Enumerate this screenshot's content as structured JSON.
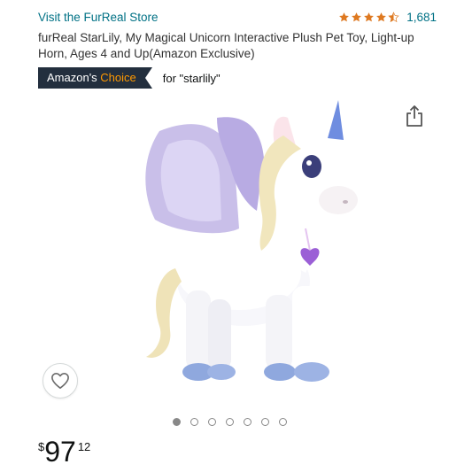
{
  "store": {
    "link_text": "Visit the FurReal Store"
  },
  "rating": {
    "stars": 4.5,
    "count": "1,681",
    "star_color": "#de7921"
  },
  "product": {
    "title": "furReal StarLily, My Magical Unicorn Interactive Plush Pet Toy, Light-up Horn, Ages 4 and Up(Amazon Exclusive)"
  },
  "badge": {
    "prefix": "Amazon's",
    "highlight": "Choice",
    "query": "for \"starlily\"",
    "bg_color": "#232f3e",
    "accent_color": "#ff9900"
  },
  "gallery": {
    "image_count": 7,
    "active_index": 0
  },
  "icons": {
    "share": "share-icon",
    "favorite": "heart-icon"
  },
  "price": {
    "symbol": "$",
    "whole": "97",
    "fraction": "12"
  }
}
